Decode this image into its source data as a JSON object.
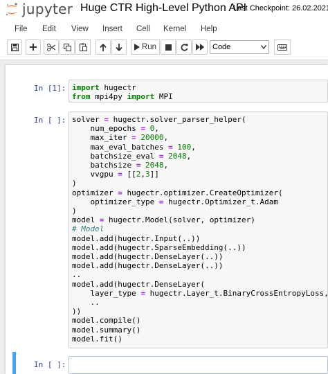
{
  "header": {
    "logo_text": "jupyter",
    "notebook_title": "Huge CTR High-Level Python API",
    "checkpoint": "Last Checkpoint: 26.02.2021"
  },
  "menu": {
    "items": [
      "File",
      "Edit",
      "View",
      "Insert",
      "Cell",
      "Kernel",
      "Help"
    ]
  },
  "toolbar": {
    "run_label": "Run",
    "cell_type": "Code",
    "icons": [
      "save-icon",
      "plus-icon",
      "cut-icon",
      "copy-icon",
      "paste-icon",
      "arrow-up-icon",
      "arrow-down-icon",
      "run-icon",
      "stop-icon",
      "restart-icon",
      "fast-forward-icon",
      "keyboard-icon"
    ]
  },
  "cells": [
    {
      "prompt": "In [1]:",
      "lines": [
        "import hugectr",
        "from mpi4py import MPI"
      ]
    },
    {
      "prompt": "In [ ]:",
      "lines": [
        "solver = hugectr.solver_parser_helper(",
        "    num_epochs = 0,",
        "    max_iter = 20000,",
        "    max_eval_batches = 100,",
        "    batchsize_eval = 2048,",
        "    batchsize = 2048,",
        "    vvgpu = [[2,3]]",
        ")",
        "optimizer = hugectr.optimizer.CreateOptimizer(",
        "    optimizer_type = hugectr.Optimizer_t.Adam",
        ")",
        "model = hugectr.Model(solver, optimizer)",
        "# Model",
        "model.add(hugectr.Input(..))",
        "model.add(hugectr.SparseEmbedding(..))",
        "model.add(hugectr.DenseLayer(..))",
        "model.add(hugectr.DenseLayer(..))",
        "..",
        "model.add(hugectr.DenseLayer(",
        "    layer_type = hugectr.Layer_t.BinaryCrossEntropyLoss,",
        "    ..",
        "))",
        "model.compile()",
        "model.summary()",
        "model.fit()"
      ]
    },
    {
      "prompt": "In [ ]:",
      "lines": []
    }
  ]
}
